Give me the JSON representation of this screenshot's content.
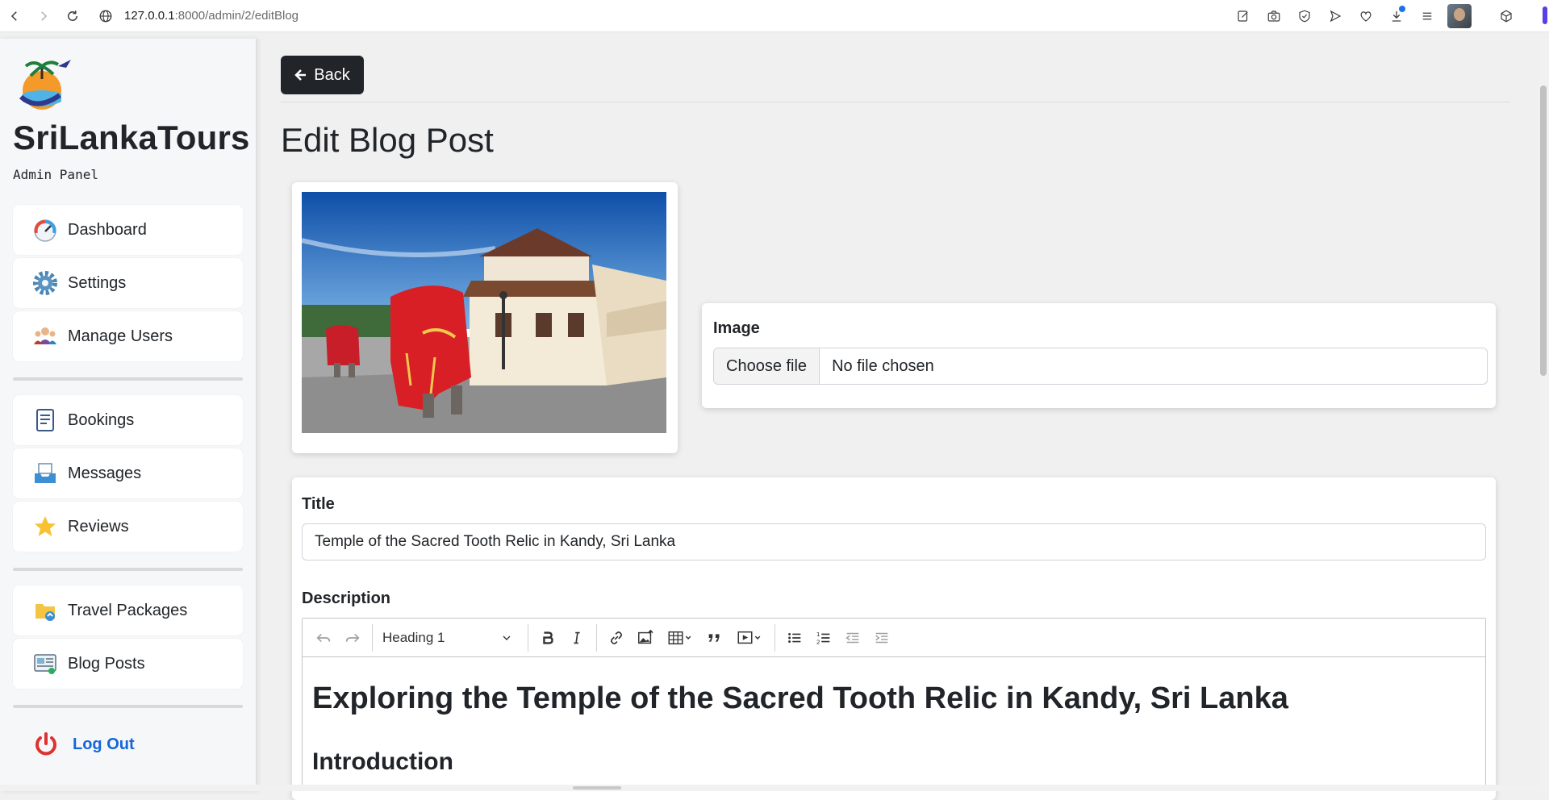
{
  "browser": {
    "url_host": "127.0.0.1",
    "url_path": ":8000/admin/2/editBlog"
  },
  "sidebar": {
    "brand": "SriLankaTours",
    "subtitle": "Admin Panel",
    "group1": [
      {
        "label": "Dashboard",
        "icon": "dashboard-icon"
      },
      {
        "label": "Settings",
        "icon": "gear-icon"
      },
      {
        "label": "Manage Users",
        "icon": "users-icon"
      }
    ],
    "group2": [
      {
        "label": "Bookings",
        "icon": "document-icon"
      },
      {
        "label": "Messages",
        "icon": "inbox-icon"
      },
      {
        "label": "Reviews",
        "icon": "star-icon"
      }
    ],
    "group3": [
      {
        "label": "Travel Packages",
        "icon": "package-icon"
      },
      {
        "label": "Blog Posts",
        "icon": "blog-icon"
      }
    ],
    "logout": "Log Out"
  },
  "main": {
    "back_label": "Back",
    "page_title": "Edit Blog Post",
    "image_label": "Image",
    "file_button": "Choose file",
    "file_status": "No file chosen",
    "title_label": "Title",
    "title_value": "Temple of the Sacred Tooth Relic in Kandy, Sri Lanka",
    "description_label": "Description",
    "heading_select": "Heading 1",
    "editor_h1": "Exploring the Temple of the Sacred Tooth Relic in Kandy, Sri Lanka",
    "editor_h2": "Introduction"
  },
  "colors": {
    "accent_dark": "#212529",
    "logout_blue": "#1565d8",
    "sidebar_bg": "#f6f7f8"
  }
}
